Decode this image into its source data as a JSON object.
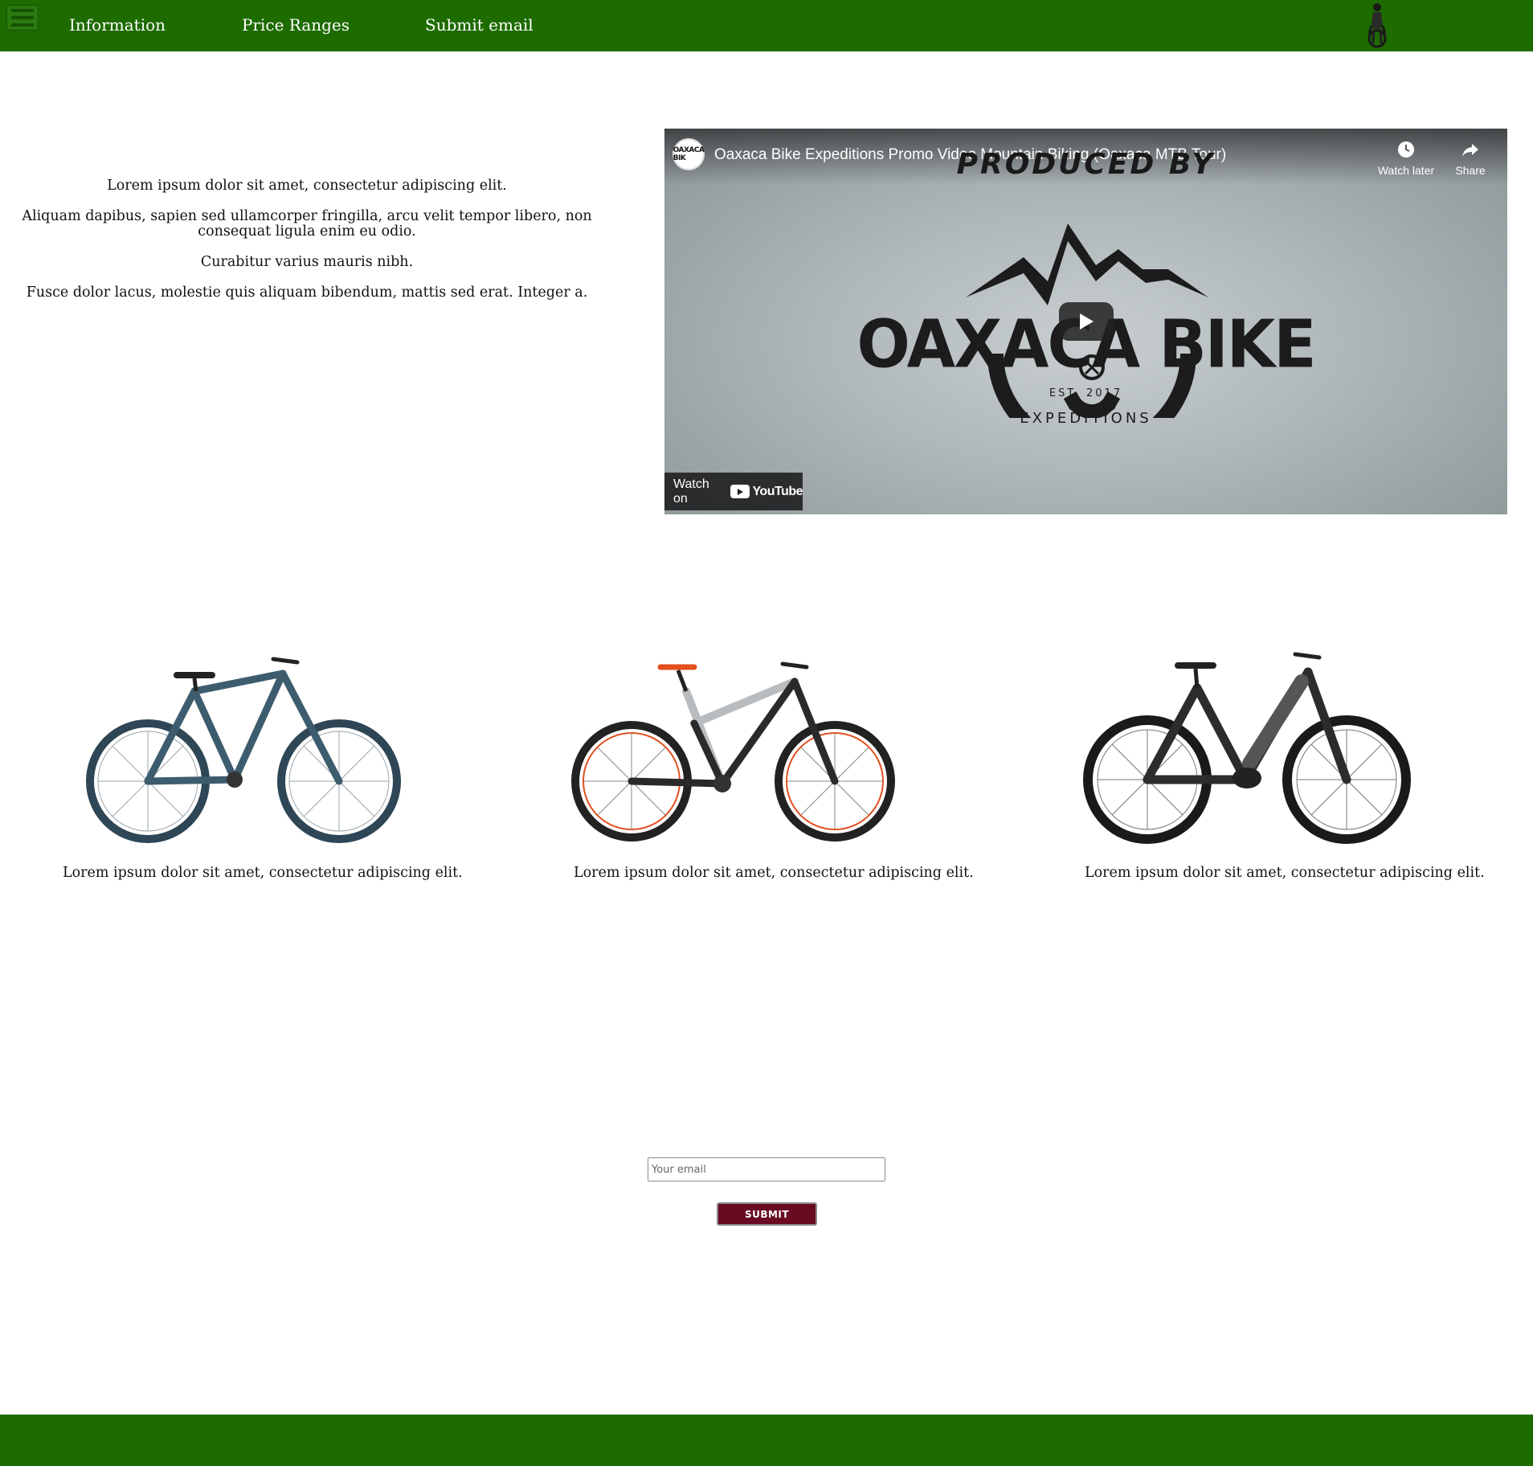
{
  "nav": {
    "menu_icon": "hamburger-menu-icon",
    "links": [
      "Information",
      "Price Ranges",
      "Submit email"
    ],
    "logo_icon": "mountain-biker-icon"
  },
  "intro": {
    "paragraphs": [
      "Lorem ipsum dolor sit amet, consectetur adipiscing elit.",
      "Aliquam dapibus, sapien sed ullamcorper fringilla, arcu velit tempor libero, non consequat ligula enim eu odio.",
      "Curabitur varius mauris nibh.",
      "Fusce dolor lacus, molestie quis aliquam bibendum, mattis sed erat. Integer a."
    ]
  },
  "video": {
    "title": "Oaxaca Bike Expeditions Promo Video Mountain Biking (Oaxaca MTB Tour)",
    "channel_avatar_text": "OAXACA BIK",
    "watch_later_label": "Watch later",
    "share_label": "Share",
    "thumbnail": {
      "produced_by": "PRODUCED BY",
      "brand": "OAXACA BIKE",
      "est": "EST.   2017",
      "expeditions": "EXPEDITIONS"
    },
    "watch_on_label": "Watch on",
    "youtube_label": "YouTube"
  },
  "bikes": [
    {
      "caption": "Lorem ipsum dolor sit amet, consectetur adipiscing elit.",
      "frame_color": "#3d5c6e",
      "style": "hardtail"
    },
    {
      "caption": "Lorem ipsum dolor sit amet, consectetur adipiscing elit.",
      "frame_color": "#b9bcbe",
      "style": "full-suspension"
    },
    {
      "caption": "Lorem ipsum dolor sit amet, consectetur adipiscing elit.",
      "frame_color": "#2a2c2e",
      "style": "e-bike"
    }
  ],
  "form": {
    "email_placeholder": "Your email",
    "email_value": "",
    "submit_label": "SUBMIT"
  },
  "colors": {
    "brand_green": "#1e6b00",
    "submit_maroon": "#6a0a22"
  }
}
